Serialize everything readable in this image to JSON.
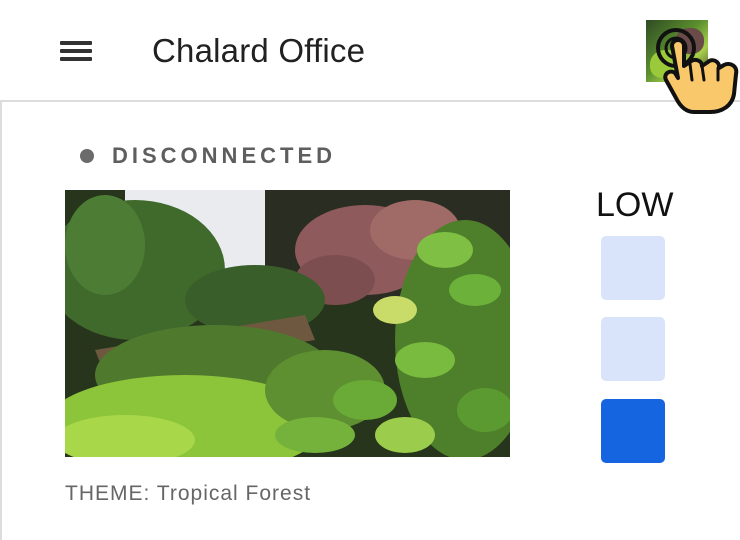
{
  "header": {
    "title": "Chalard Office",
    "menu_icon": "hamburger-menu-icon",
    "avatar_icon": "terrarium-thumbnail"
  },
  "status": {
    "text": "DISCONNECTED",
    "dot_color": "#6b6b6b"
  },
  "theme": {
    "label": "THEME: Tropical Forest"
  },
  "level": {
    "label": "LOW",
    "blocks": [
      {
        "state": "inactive",
        "color": "#d9e4fb"
      },
      {
        "state": "inactive",
        "color": "#d9e4fb"
      },
      {
        "state": "active",
        "color": "#1565e0"
      }
    ]
  },
  "colors": {
    "divider": "#dcdcdc",
    "title": "#212121",
    "accent": "#1565e0",
    "accent_light": "#d9e4fb"
  }
}
